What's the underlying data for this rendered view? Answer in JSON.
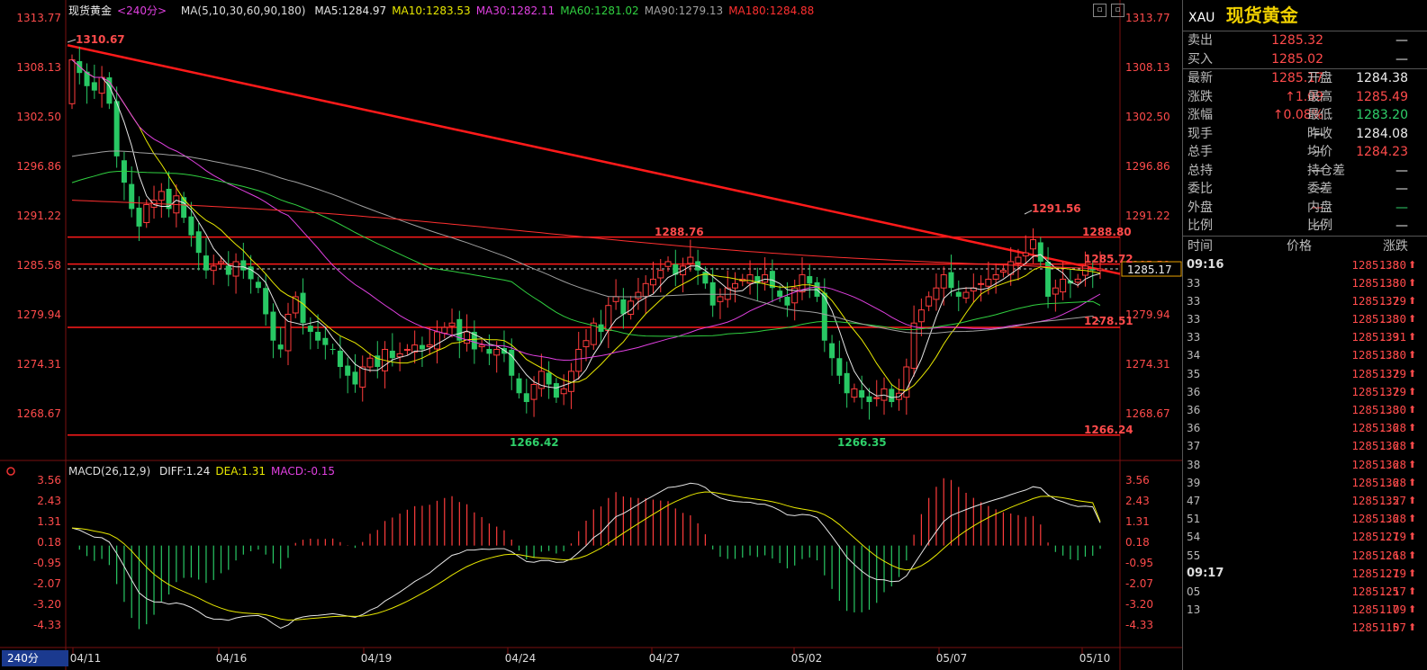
{
  "chart": {
    "title": "现货黄金",
    "period": "<240分>",
    "ma_params": "MA(5,10,30,60,90,180)",
    "ma_values": [
      {
        "label": "MA5:1284.97",
        "color": "#e6e6e6"
      },
      {
        "label": "MA10:1283.53",
        "color": "#e8e800"
      },
      {
        "label": "MA30:1282.11",
        "color": "#e040e0"
      },
      {
        "label": "MA60:1281.02",
        "color": "#30d040"
      },
      {
        "label": "MA90:1279.13",
        "color": "#a0a0a0"
      },
      {
        "label": "MA180:1284.88",
        "color": "#ff3030"
      }
    ],
    "macd_params": "MACD(26,12,9)",
    "macd_values": [
      {
        "label": "DIFF:1.24",
        "color": "#e6e6e6"
      },
      {
        "label": "DEA:1.31",
        "color": "#e8e800"
      },
      {
        "label": "MACD:-0.15",
        "color": "#e040e0"
      }
    ],
    "period_button": "240分",
    "current_price_tag": "1285.17",
    "price_levels": [
      "1313.77",
      "1308.13",
      "1302.50",
      "1296.86",
      "1291.22",
      "1285.58",
      "1279.94",
      "1274.31",
      "1268.67"
    ],
    "macd_levels": [
      "3.56",
      "2.43",
      "1.31",
      "0.18",
      "-0.95",
      "-2.07",
      "-3.20",
      "-4.33"
    ],
    "dates": [
      "04/11",
      "04/16",
      "04/19",
      "04/24",
      "04/27",
      "05/02",
      "05/07",
      "05/10"
    ],
    "annotations": [
      {
        "text": "1310.67",
        "color": "#ff4b4b"
      },
      {
        "text": "1288.76",
        "color": "#ff4b4b"
      },
      {
        "text": "1291.56",
        "color": "#ff4b4b"
      },
      {
        "text": "1288.80",
        "color": "#ff4b4b"
      },
      {
        "text": "1285.72",
        "color": "#ff4b4b"
      },
      {
        "text": "1278.51",
        "color": "#ff4b4b"
      },
      {
        "text": "1266.24",
        "color": "#ff4b4b"
      },
      {
        "text": "1266.42",
        "color": "#2fd06a"
      },
      {
        "text": "1266.35",
        "color": "#2fd06a"
      }
    ],
    "colors": {
      "up": "#ff3c3c",
      "down": "#28c864",
      "trend": "#ff1a1a"
    }
  },
  "quote": {
    "code": "XAU",
    "name": "现货黄金",
    "sell_label": "卖出",
    "sell": "1285.32",
    "sell_qty": "—",
    "buy_label": "买入",
    "buy": "1285.02",
    "buy_qty": "—",
    "rows": [
      {
        "l": "最新",
        "v": "1285.17",
        "vc": "red",
        "l2": "开盘",
        "v2": "1284.38",
        "v2c": "white"
      },
      {
        "l": "涨跌",
        "v": "↑1.09",
        "vc": "red",
        "l2": "最高",
        "v2": "1285.49",
        "v2c": "red"
      },
      {
        "l": "涨幅",
        "v": "↑0.08%",
        "vc": "red",
        "l2": "最低",
        "v2": "1283.20",
        "v2c": "green"
      },
      {
        "l": "现手",
        "v": "—",
        "vc": "white",
        "l2": "昨收",
        "v2": "1284.08",
        "v2c": "white"
      },
      {
        "l": "总手",
        "v": "—",
        "vc": "white",
        "l2": "均价",
        "v2": "1284.23",
        "v2c": "red"
      },
      {
        "l": "总持",
        "v": "—",
        "vc": "white",
        "l2": "持仓差",
        "v2": "—",
        "v2c": "white"
      },
      {
        "l": "委比",
        "v": "—",
        "vc": "white",
        "l2": "委差",
        "v2": "—",
        "v2c": "white"
      },
      {
        "l": "外盘",
        "v": "—",
        "vc": "red",
        "l2": "内盘",
        "v2": "—",
        "v2c": "green"
      },
      {
        "l": "比例",
        "v": "—",
        "vc": "white",
        "l2": "比例",
        "v2": "—",
        "v2c": "white"
      }
    ],
    "tick_header": {
      "time": "时间",
      "price": "价格",
      "change": "涨跌"
    },
    "ticks": [
      {
        "t": "09:16",
        "p": "1285.38",
        "c": "1.30"
      },
      {
        "t": "33",
        "p": "1285.38",
        "c": "1.30"
      },
      {
        "t": "33",
        "p": "1285.37",
        "c": "1.29"
      },
      {
        "t": "33",
        "p": "1285.38",
        "c": "1.30"
      },
      {
        "t": "33",
        "p": "1285.39",
        "c": "1.31"
      },
      {
        "t": "34",
        "p": "1285.38",
        "c": "1.30"
      },
      {
        "t": "35",
        "p": "1285.37",
        "c": "1.29"
      },
      {
        "t": "36",
        "p": "1285.37",
        "c": "1.29"
      },
      {
        "t": "36",
        "p": "1285.38",
        "c": "1.30"
      },
      {
        "t": "36",
        "p": "1285.36",
        "c": "1.28"
      },
      {
        "t": "37",
        "p": "1285.36",
        "c": "1.28"
      },
      {
        "t": "38",
        "p": "1285.36",
        "c": "1.28"
      },
      {
        "t": "39",
        "p": "1285.36",
        "c": "1.28"
      },
      {
        "t": "47",
        "p": "1285.35",
        "c": "1.27"
      },
      {
        "t": "51",
        "p": "1285.36",
        "c": "1.28"
      },
      {
        "t": "54",
        "p": "1285.27",
        "c": "1.19"
      },
      {
        "t": "55",
        "p": "1285.26",
        "c": "1.18"
      },
      {
        "t": "09:17",
        "p": "1285.27",
        "c": "1.19"
      },
      {
        "t": "05",
        "p": "1285.25",
        "c": "1.17"
      },
      {
        "t": "13",
        "p": "1285.17",
        "c": "1.09"
      },
      {
        "t": "",
        "p": "1285.15",
        "c": "1.07"
      }
    ]
  }
}
